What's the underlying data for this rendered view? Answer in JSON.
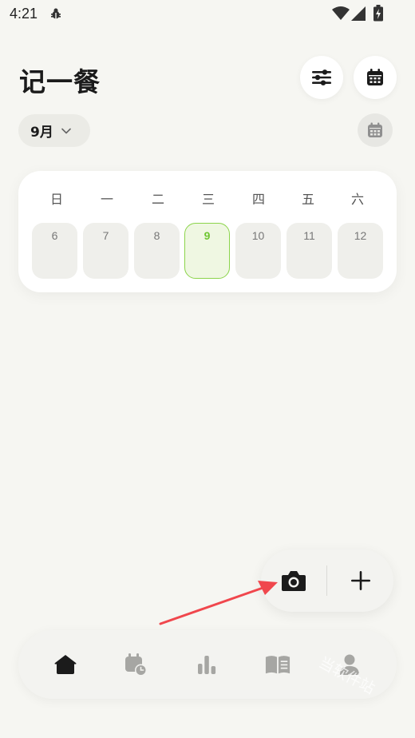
{
  "status_bar": {
    "time": "4:21",
    "icons": [
      "bug-icon",
      "wifi-icon",
      "signal-icon",
      "battery-icon"
    ]
  },
  "header": {
    "title": "记一餐",
    "buttons": [
      "sliders-icon",
      "calendar-icon"
    ]
  },
  "month_selector": {
    "label": "9月",
    "icon": "chevron-down-icon"
  },
  "week": {
    "weekdays": [
      "日",
      "一",
      "二",
      "三",
      "四",
      "五",
      "六"
    ],
    "days": [
      "6",
      "7",
      "8",
      "9",
      "10",
      "11",
      "12"
    ],
    "selected_day": "9"
  },
  "actions": {
    "icons": [
      "camera-icon",
      "plus-icon"
    ]
  },
  "bottom_nav": {
    "items": [
      "home-icon",
      "calendar-clock-icon",
      "bar-chart-icon",
      "book-icon",
      "profile-icon"
    ],
    "active": "home-icon"
  },
  "watermark": "当软件站",
  "colors": {
    "background": "#f6f6f2",
    "accent_green": "#8bd44a",
    "annotation_red": "#f0474d",
    "text_dark": "#1b1b1b"
  }
}
